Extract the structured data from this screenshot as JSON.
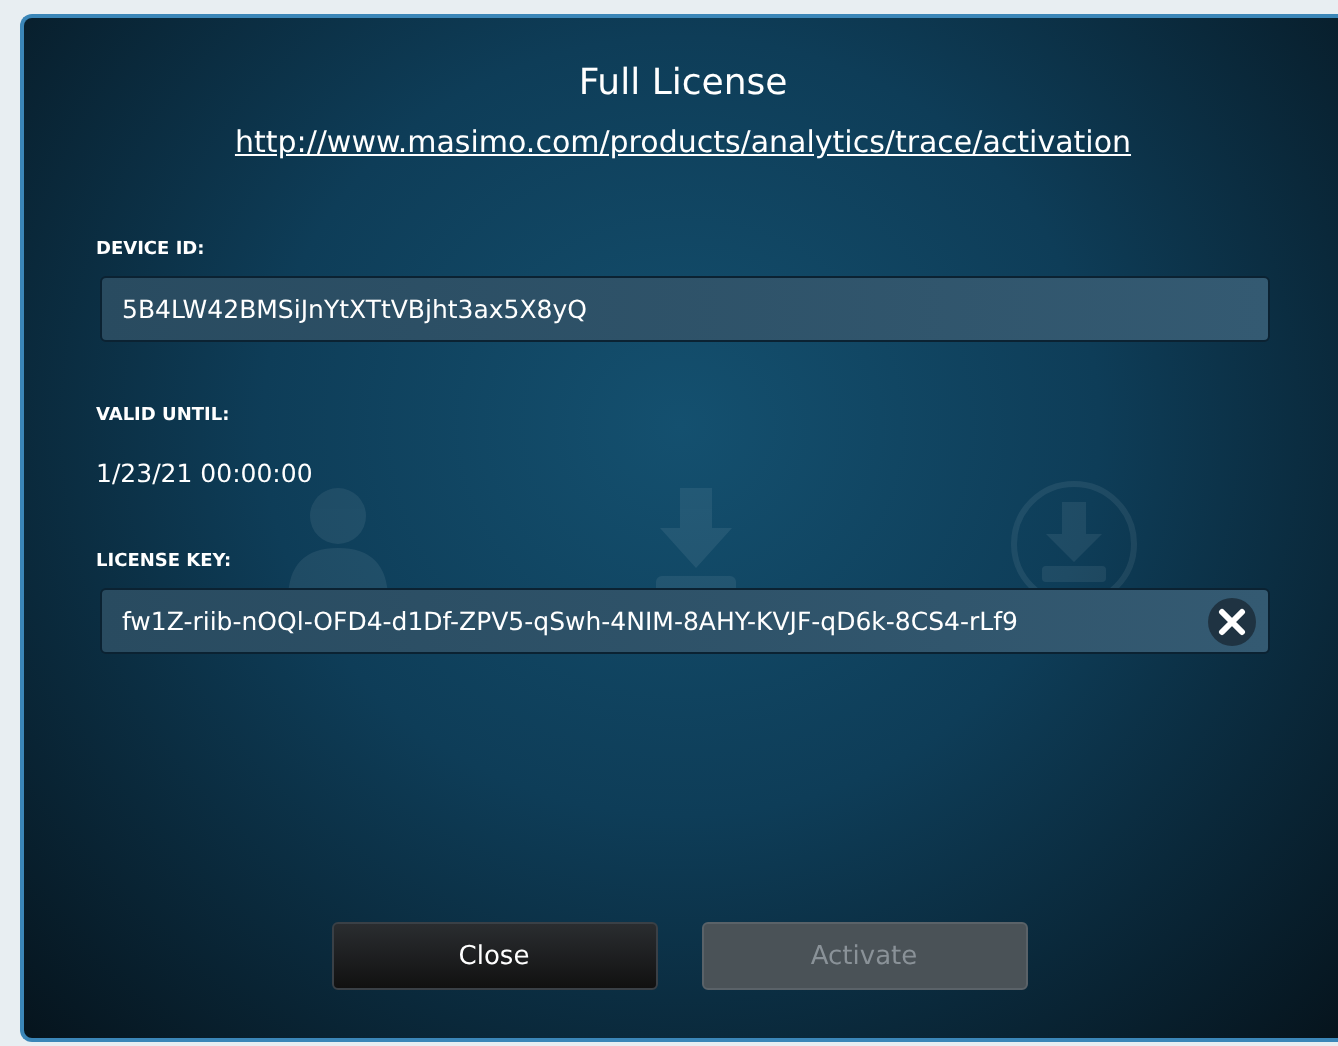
{
  "dialog": {
    "title": "Full License",
    "link": "http://www.masimo.com/products/analytics/trace/activation"
  },
  "fields": [
    {
      "kind": "field",
      "label": "DEVICE ID:",
      "value": "5B4LW42BMSiJnYtXTtVBjht3ax5X8yQ",
      "clearable": false
    },
    {
      "kind": "text",
      "label": "VALID UNTIL:",
      "value": "1/23/21 00:00:00"
    },
    {
      "kind": "field",
      "label": "LICENSE KEY:",
      "value": "fw1Z-riib-nOQl-OFD4-d1Df-ZPV5-qSwh-4NIM-8AHY-KVJF-qD6k-8CS4-rLf9",
      "clearable": true
    }
  ],
  "buttons": [
    {
      "label": "Close",
      "disabled": false
    },
    {
      "label": "Activate",
      "disabled": true
    }
  ]
}
